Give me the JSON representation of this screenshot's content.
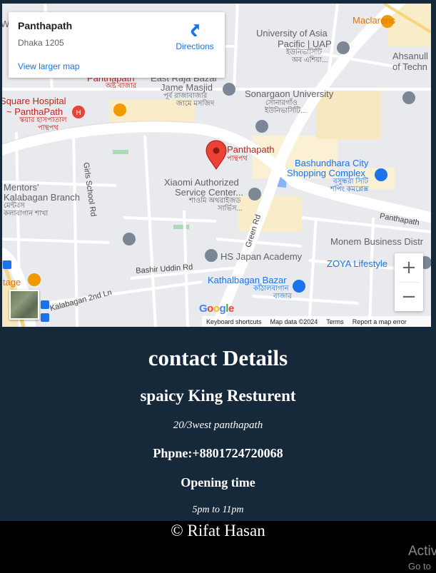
{
  "map": {
    "info": {
      "title": "Panthapath",
      "address": "Dhaka 1205",
      "larger_map": "View larger map",
      "directions": "Directions"
    },
    "labels": {
      "panthapath_pin": "Panthapath",
      "panthapath_bn": "পান্থপথ",
      "maclarens": "Maclarens",
      "university_asia": "University of Asia",
      "pacific_uap": "Pacific | UAP",
      "uap_bn": "ইউনিভার্সিটি",
      "uap_bn2": "অব এশিয়া...",
      "ahsanullah": "Ahsanull",
      "of_tech": "of Techn",
      "sonargaon": "Sonargaon University",
      "sonargaon_bn": "সোনারগাঁও",
      "sonargaon_bn2": "ইউনিভার্সিটি...",
      "east_raja": "East Raja Bazar",
      "jame_masjid": "Jame Masjid",
      "jame_bn": "পূর্ব রাজাবাজার",
      "jame_bn2": "জামে মসজিদ",
      "square_hospital": "Square Hospital",
      "panthapath_h": "~ PanthaPath",
      "hospital_bn": "স্কয়ার হাসপাতাল",
      "hospital_bn2": "পান্থপথ",
      "panthapath_top": "Panthapath",
      "panthapath_top_bn": "অষ্ট বাজার",
      "bashundhara_city": "Bashundhara City",
      "shopping_complex": "Shopping Complex",
      "bashundhara_bn": "বসুন্ধরা সিটি",
      "bashundhara_bn2": "শপিং কমপ্লেক্স",
      "xiaomi": "Xiaomi Authorized",
      "service_center": "Service Center...",
      "xiaomi_bn": "শাওমি অথরাইজড",
      "xiaomi_bn2": "সার্ভিস...",
      "mentors": "Mentors'",
      "kalabagan_branch": "Kalabagan Branch",
      "mentors_bn": "মেন্টরস",
      "mentors_bn2": "কলাবাগান শাখা",
      "girls_school_rd": "Girls School Rd",
      "green_rd": "Green Rd",
      "panthapath_road": "Panthapath",
      "monem": "Monem Business Distr",
      "zoya": "ZOYA Lifestyle",
      "hs_japan": "HS Japan Academy",
      "bashir_uddin": "Bashir Uddin Rd",
      "kathalbagan": "Kathalbagan Bazar",
      "kathalbagan_bn": "কাঁঠালবাগান",
      "kathalbagan_bn2": "বাজার",
      "kalabagan_2nd": "Kalabagan 2nd Ln",
      "itage": "itage",
      "we": "We"
    },
    "google": "Google",
    "footer": {
      "shortcuts": "Keyboard shortcuts",
      "map_data": "Map data ©2024",
      "terms": "Terms",
      "report": "Report a map error"
    },
    "zoom_in": "+",
    "zoom_out": "−"
  },
  "contact": {
    "heading": "contact Details",
    "restaurant": "spaicy King Resturent",
    "address": "20/3west panthapath",
    "phone": "Phpne:+8801724720068",
    "opening_label": "Opening time",
    "hours": "5pm to 11pm"
  },
  "footer": {
    "copyright": "© Rifat Hasan",
    "activate": "Activ",
    "activate_sub": "Go to"
  },
  "colors": {
    "page_bg": "#16293b",
    "footer_bg": "#000000",
    "map_bg": "#e9eaed",
    "link_blue": "#1a73e8",
    "pin_red": "#ea4335"
  }
}
